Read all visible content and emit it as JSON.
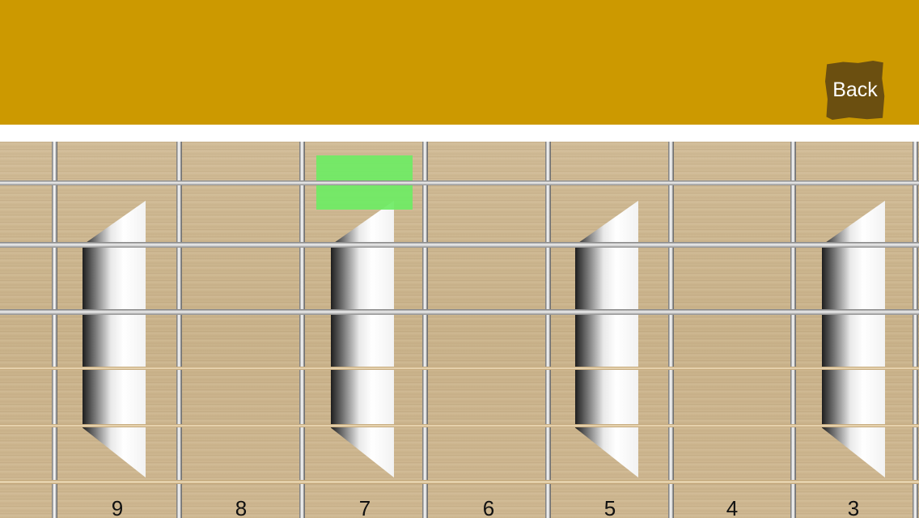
{
  "header": {
    "back_label": "Back",
    "color": "#cc9900"
  },
  "fret_numbers": [
    "9",
    "8",
    "7",
    "6",
    "5",
    "4",
    "3"
  ],
  "highlight": {
    "color": "#6eeb64"
  }
}
